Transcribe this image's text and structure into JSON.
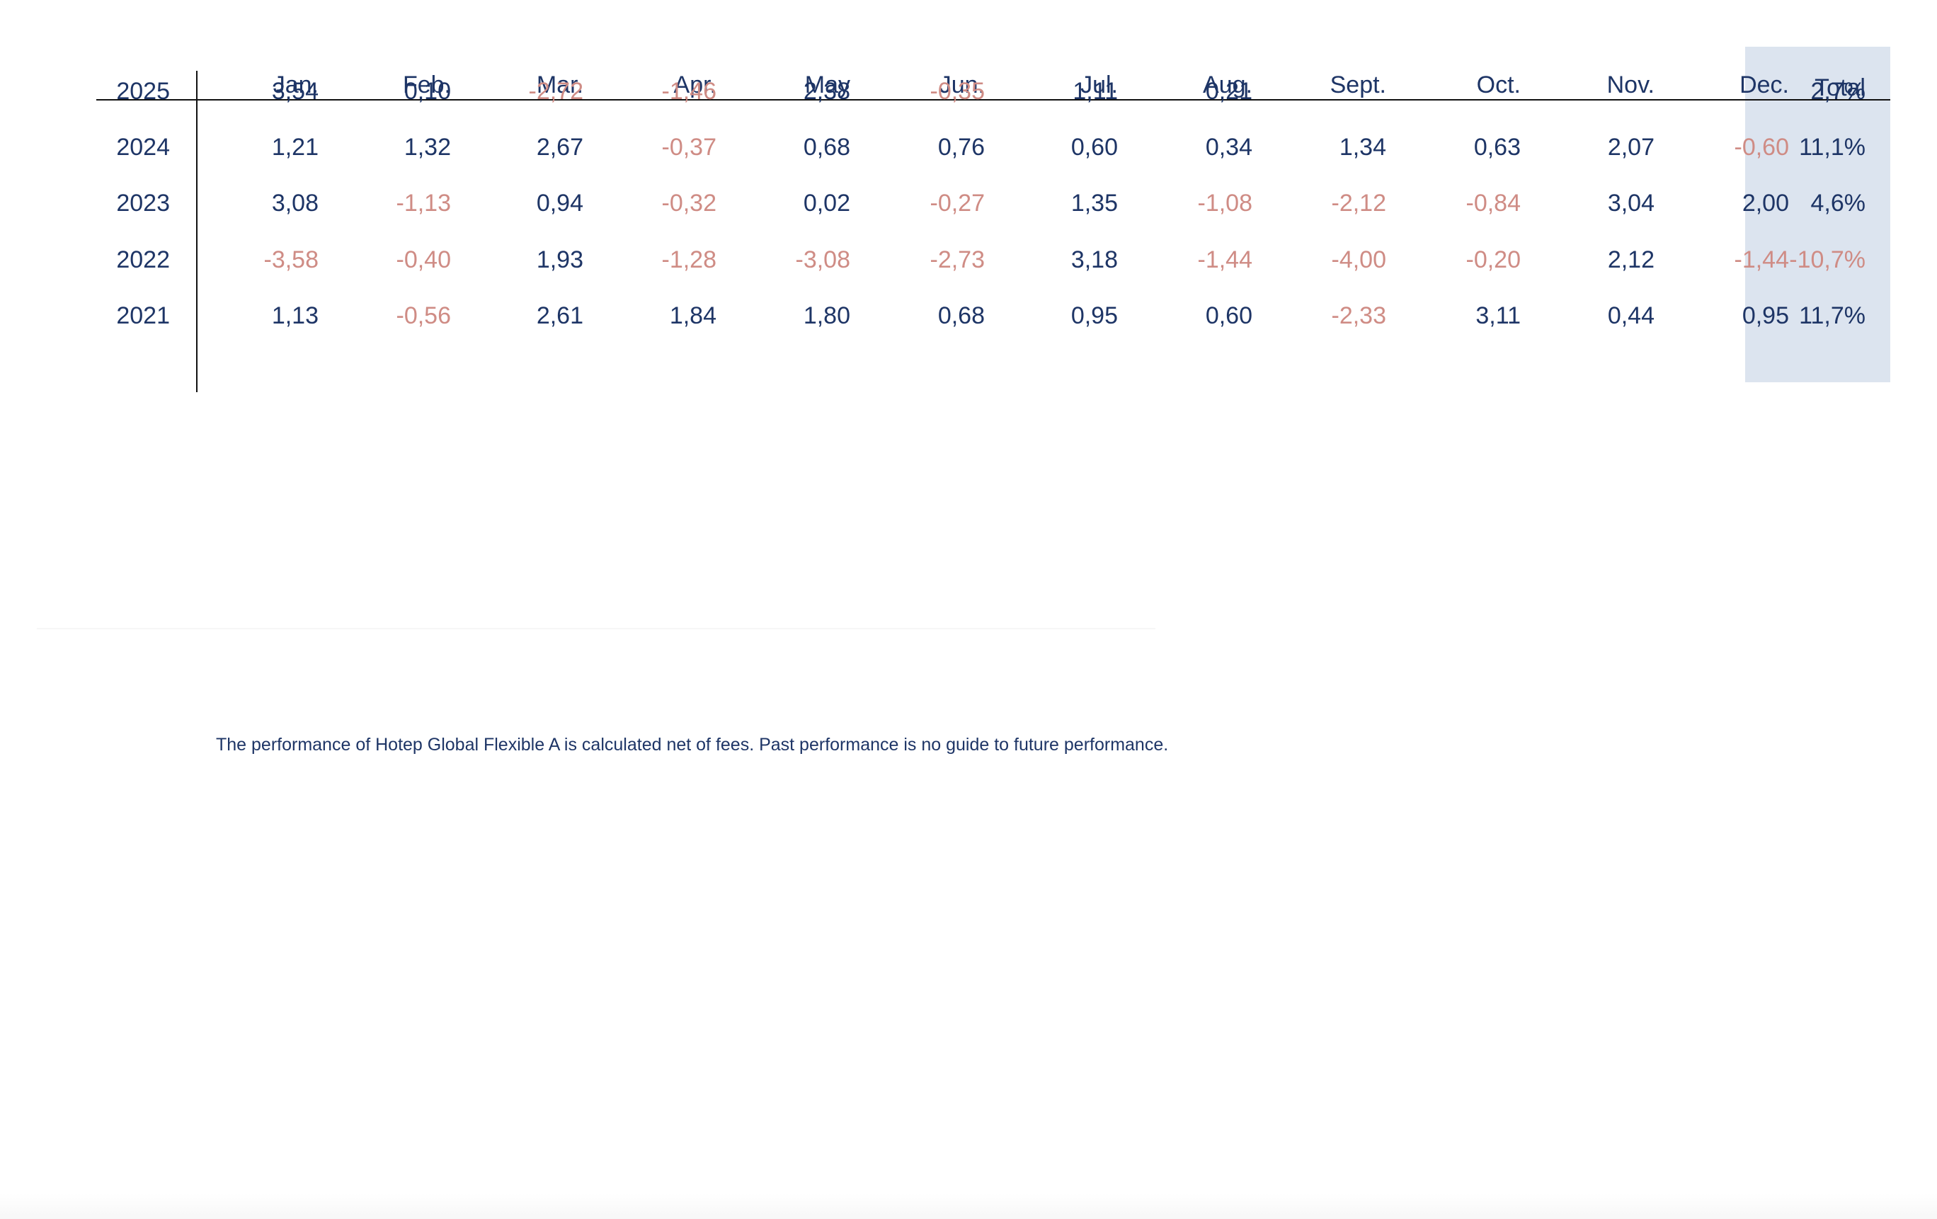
{
  "table": {
    "months": [
      "Jan.",
      "Feb.",
      "Mar.",
      "Apr.",
      "May",
      "Jun.",
      "Jul.",
      "Aug.",
      "Sept.",
      "Oct.",
      "Nov.",
      "Dec."
    ],
    "total_label": "Total",
    "rows": [
      {
        "year": "2025",
        "values": [
          "3,54",
          "0,10",
          "-2,72",
          "-1,46",
          "2,38",
          "-0,35",
          "1,11",
          "0,21",
          "",
          "",
          "",
          ""
        ],
        "total": "2,7%"
      },
      {
        "year": "2024",
        "values": [
          "1,21",
          "1,32",
          "2,67",
          "-0,37",
          "0,68",
          "0,76",
          "0,60",
          "0,34",
          "1,34",
          "0,63",
          "2,07",
          "-0,60"
        ],
        "total": "11,1%"
      },
      {
        "year": "2023",
        "values": [
          "3,08",
          "-1,13",
          "0,94",
          "-0,32",
          "0,02",
          "-0,27",
          "1,35",
          "-1,08",
          "-2,12",
          "-0,84",
          "3,04",
          "2,00"
        ],
        "total": "4,6%"
      },
      {
        "year": "2022",
        "values": [
          "-3,58",
          "-0,40",
          "1,93",
          "-1,28",
          "-3,08",
          "-2,73",
          "3,18",
          "-1,44",
          "-4,00",
          "-0,20",
          "2,12",
          "-1,44"
        ],
        "total": "-10,7%"
      },
      {
        "year": "2021",
        "values": [
          "1,13",
          "-0,56",
          "2,61",
          "1,84",
          "1,80",
          "0,68",
          "0,95",
          "0,60",
          "-2,33",
          "3,11",
          "0,44",
          "0,95"
        ],
        "total": "11,7%"
      }
    ]
  },
  "footnote": "The performance of Hotep Global Flexible A  is calculated net of fees. Past performance is no guide to future performance.",
  "colors": {
    "positive_text": "#1e3566",
    "negative_text": "#cf8c85",
    "total_band": "#dce4ef"
  }
}
